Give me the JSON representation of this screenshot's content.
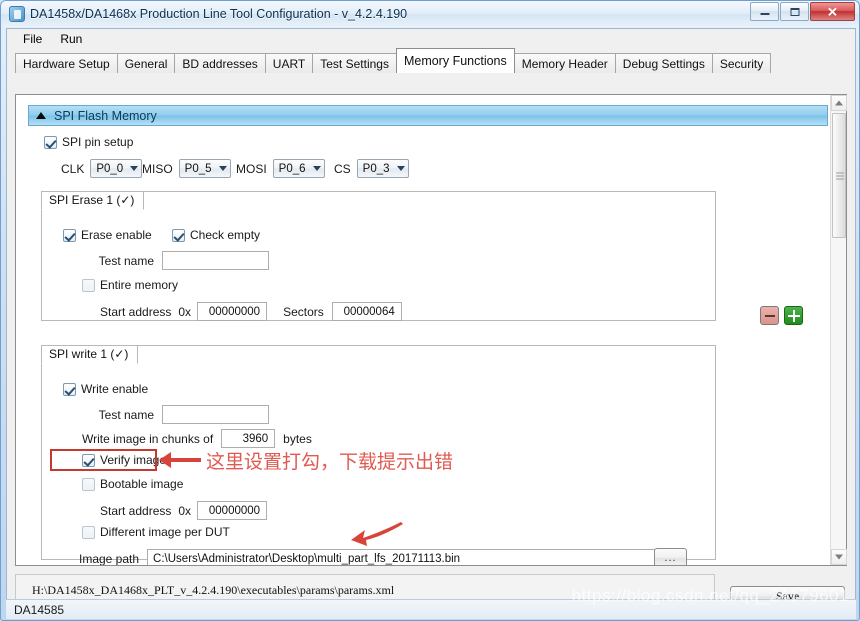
{
  "window": {
    "title": "DA1458x/DA1468x Production Line Tool Configuration - v_4.2.4.190",
    "app_icon": "app-icon",
    "minimize_label": "",
    "maximize_label": "",
    "close_label": "✕"
  },
  "menu": {
    "items": [
      {
        "label": "File"
      },
      {
        "label": "Run"
      }
    ]
  },
  "tabs": [
    {
      "label": "Hardware Setup",
      "active": false
    },
    {
      "label": "General",
      "active": false
    },
    {
      "label": "BD addresses",
      "active": false
    },
    {
      "label": "UART",
      "active": false
    },
    {
      "label": "Test Settings",
      "active": false
    },
    {
      "label": "Memory Functions",
      "active": true
    },
    {
      "label": "Memory Header",
      "active": false
    },
    {
      "label": "Debug Settings",
      "active": false
    },
    {
      "label": "Security",
      "active": false
    }
  ],
  "group": {
    "header_label": "SPI Flash Memory",
    "collapse_icon": "triangle-up-icon"
  },
  "pin_setup": {
    "enabled_label": "SPI pin setup",
    "enabled": true,
    "pins": [
      {
        "label": "CLK",
        "value": "P0_0"
      },
      {
        "label": "MISO",
        "value": "P0_5"
      },
      {
        "label": "MOSI",
        "value": "P0_6"
      },
      {
        "label": "CS",
        "value": "P0_3"
      }
    ]
  },
  "erase_section": {
    "tab_label": "SPI Erase 1 (✓)",
    "erase_enable_label": "Erase enable",
    "erase_enable": true,
    "check_empty_label": "Check empty",
    "check_empty": true,
    "test_name_label": "Test name",
    "test_name_value": "",
    "entire_memory_label": "Entire memory",
    "entire_memory": false,
    "start_address_label": "Start address",
    "hex_prefix": "0x",
    "start_address_value": "00000000",
    "sectors_label": "Sectors",
    "sectors_value": "00000064"
  },
  "write_section": {
    "tab_label": "SPI write 1 (✓)",
    "write_enable_label": "Write enable",
    "write_enable": true,
    "test_name_label": "Test name",
    "test_name_value": "",
    "chunks_label": "Write image in chunks of",
    "chunks_value": "3960",
    "chunks_unit": "bytes",
    "verify_image_label": "Verify image",
    "verify_image": true,
    "bootable_image_label": "Bootable image",
    "bootable_image": false,
    "start_address_label": "Start address",
    "hex_prefix": "0x",
    "start_address_value": "00000000",
    "different_image_label": "Different image per DUT",
    "different_image": false,
    "image_path_label": "Image path",
    "image_path_value": "C:\\Users\\Administrator\\Desktop\\multi_part_lfs_20171113.bin",
    "browse_label": "..."
  },
  "side_buttons": {
    "remove_label": "−",
    "add_label": "+"
  },
  "annotations": {
    "verify_note": "这里设置打勾，下载提示出错",
    "highlight_color": "#c43a2e",
    "text_color": "#e05a52"
  },
  "footer": {
    "config_path": "H:\\DA1458x_DA1468x_PLT_v_4.2.4.190\\executables\\params\\params.xml",
    "save_label": "Save"
  },
  "statusbar": {
    "device": "DA14585"
  },
  "watermark": {
    "text": "https://blog.csdn.net/qq_24179601"
  }
}
